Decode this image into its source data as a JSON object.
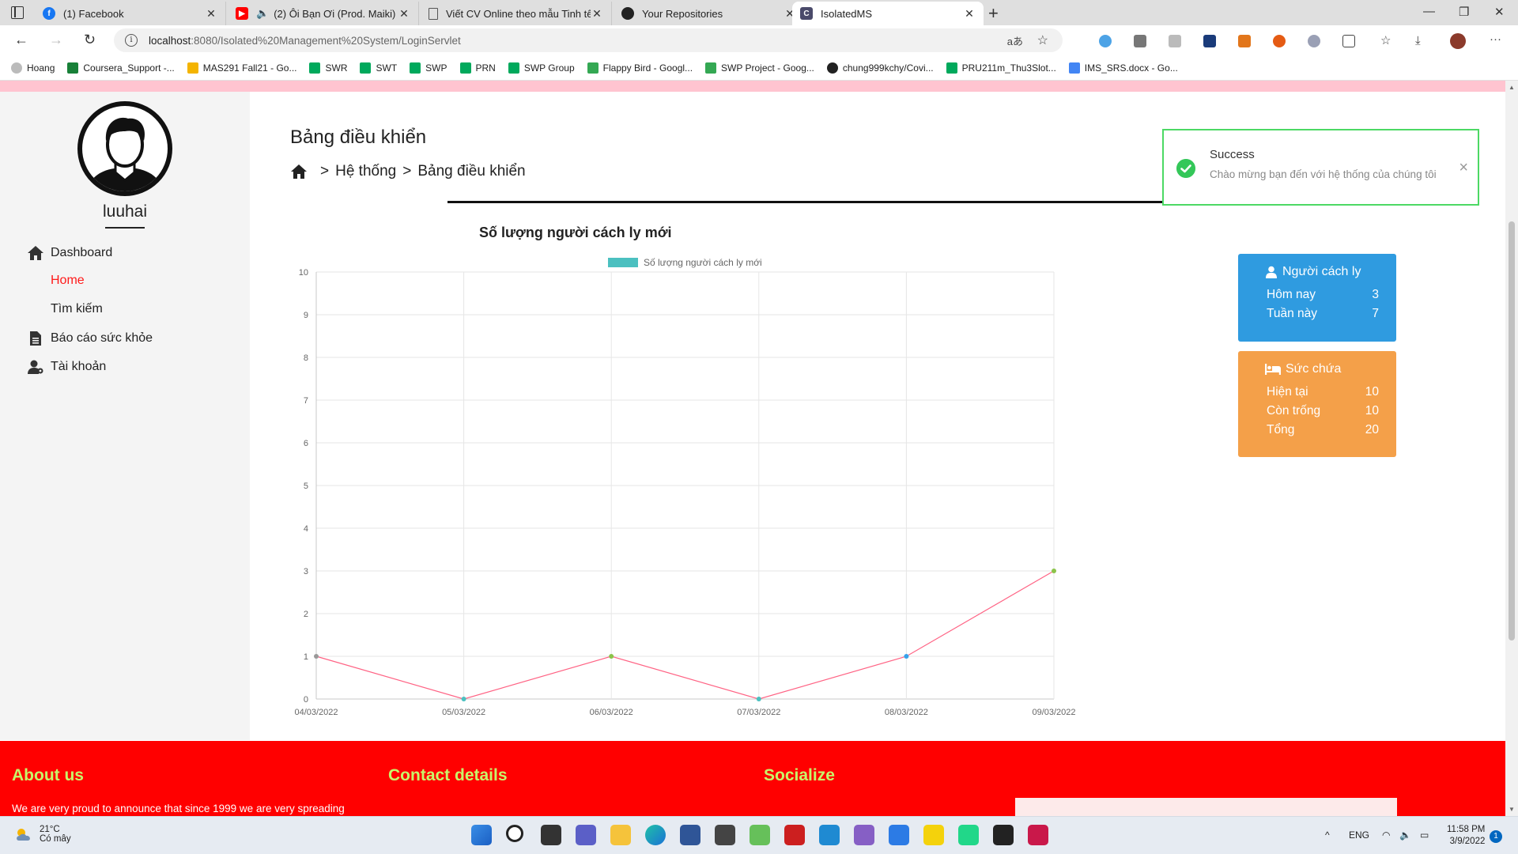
{
  "browser": {
    "tabs": [
      {
        "label": "(1) Facebook",
        "color": "#1877f2",
        "glyph": "f"
      },
      {
        "label": "(2) Ôi Bạn Ơi (Prod. Maiki) |",
        "color": "#ff0000",
        "glyph": "▶"
      },
      {
        "label": "Viết CV Online theo mẫu Tinh tế",
        "color": "#888888",
        "glyph": ""
      },
      {
        "label": "Your Repositories",
        "color": "#222222",
        "glyph": ""
      },
      {
        "label": "IsolatedMS",
        "color": "#4a4a6a",
        "glyph": "C"
      }
    ],
    "address": {
      "host": "localhost",
      "path": ":8080/Isolated%20Management%20System/LoginServlet"
    },
    "bookmarks": [
      {
        "label": "Hoang",
        "color": "#bbbbbb"
      },
      {
        "label": "Coursera_Support -...",
        "color": "#188038"
      },
      {
        "label": "MAS291 Fall21 - Go...",
        "color": "#f4b400"
      },
      {
        "label": "SWR",
        "color": "#00a95c"
      },
      {
        "label": "SWT",
        "color": "#00a95c"
      },
      {
        "label": "SWP",
        "color": "#00a95c"
      },
      {
        "label": "PRN",
        "color": "#00a95c"
      },
      {
        "label": "SWP Group",
        "color": "#00a95c"
      },
      {
        "label": "Flappy Bird - Googl...",
        "color": "#34a853"
      },
      {
        "label": "SWP Project - Goog...",
        "color": "#34a853"
      },
      {
        "label": "chung999kchy/Covi...",
        "color": "#222222"
      },
      {
        "label": "PRU211m_Thu3Slot...",
        "color": "#00a95c"
      },
      {
        "label": "IMS_SRS.docx - Go...",
        "color": "#4285f4"
      }
    ]
  },
  "sidebar": {
    "username": "luuhai",
    "items": [
      {
        "label": "Dashboard"
      },
      {
        "label": "Home"
      },
      {
        "label": "Tìm kiếm"
      },
      {
        "label": "Báo cáo sức khỏe"
      },
      {
        "label": "Tài khoản"
      }
    ]
  },
  "header": {
    "title": "Bảng điều khiển",
    "breadcrumb": {
      "sep1": ">",
      "level1": "Hệ thống",
      "sep2": ">",
      "level2": "Bảng điều khiển"
    }
  },
  "chart_data": {
    "type": "line",
    "title": "Số lượng người cách ly mới",
    "categories": [
      "04/03/2022",
      "05/03/2022",
      "06/03/2022",
      "07/03/2022",
      "08/03/2022",
      "09/03/2022"
    ],
    "series": [
      {
        "name": "Số lượng người cách ly mới",
        "values": [
          1,
          0,
          1,
          0,
          1,
          3
        ],
        "color": "#ff6384"
      }
    ],
    "legend_swatch_color": "#4bc0c0",
    "point_colors": [
      "#999999",
      "#4bc0c0",
      "#8bc34a",
      "#4bc0c0",
      "#36a2eb",
      "#8bc34a"
    ],
    "ylim": [
      0,
      10
    ],
    "yticks": [
      0,
      1,
      2,
      3,
      4,
      5,
      6,
      7,
      8,
      9,
      10
    ],
    "grid": true,
    "legend": "top"
  },
  "stats": {
    "isolated": {
      "title": "Người cách ly",
      "today_label": "Hôm nay",
      "today_value": "3",
      "week_label": "Tuần này",
      "week_value": "7",
      "color": "#2f9be0"
    },
    "capacity": {
      "title": "Sức chứa",
      "current_label": "Hiện tại",
      "current_value": "10",
      "empty_label": "Còn trống",
      "empty_value": "10",
      "total_label": "Tổng",
      "total_value": "20",
      "color": "#f4a049"
    }
  },
  "toast": {
    "title": "Success",
    "message": "Chào mừng bạn đến với hệ thống của chúng tôi",
    "close": "×"
  },
  "footer": {
    "about_title": "About us",
    "about_text": "We are very proud to announce that since 1999 we are very spreading",
    "contact_title": "Contact details",
    "social_title": "Socialize"
  },
  "taskbar": {
    "temperature": "21°C",
    "weather": "Có mây",
    "language": "ENG",
    "time": "11:58 PM",
    "date": "3/9/2022",
    "notifications": "1"
  }
}
